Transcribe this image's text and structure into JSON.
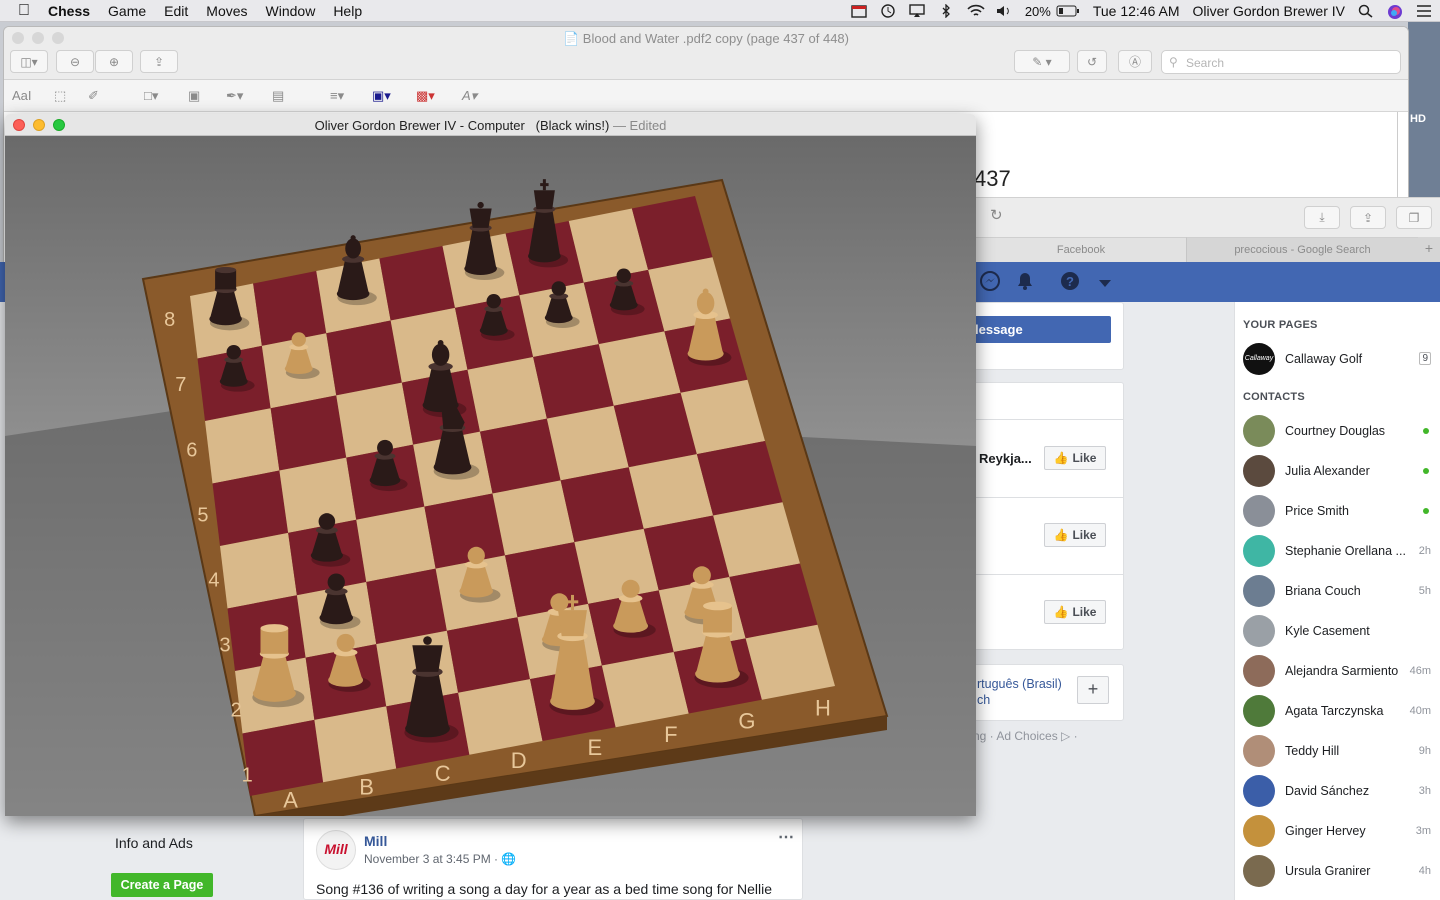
{
  "menubar": {
    "app": "Chess",
    "items": [
      "Game",
      "Edit",
      "Moves",
      "Window",
      "Help"
    ],
    "battery": "20%",
    "clock": "Tue 12:46 AM",
    "user": "Oliver Gordon Brewer IV"
  },
  "preview": {
    "title": "Blood and Water .pdf2 copy (page 437 of 448)",
    "search_placeholder": "Search",
    "page_fragment": "437",
    "hd_label": "HD",
    "markup_text_tool": "AaI"
  },
  "safari": {
    "tabs": [
      "Facebook",
      "precocious - Google Search"
    ]
  },
  "facebook": {
    "message_button": "lessage",
    "card_text": "Reykja...",
    "like_label": "Like",
    "language_links": [
      "rtuguês (Brasil)",
      "ch"
    ],
    "footer": "ng · Ad Choices ▷ ·",
    "info_and_ads": "Info and Ads",
    "create_page": "Create a Page",
    "post": {
      "author": "Mill",
      "time": "November 3 at 3:45 PM · ",
      "text": "Song #136 of writing a song a day for a year as a bed time song for Nellie",
      "avatar_text": "Mill"
    },
    "sidebar": {
      "your_pages": "YOUR PAGES",
      "page_name": "Callaway Golf",
      "page_count": "9",
      "contacts_header": "CONTACTS",
      "contacts": [
        {
          "name": "Courtney Douglas",
          "status": "online",
          "color": "#7a8b5a"
        },
        {
          "name": "Julia Alexander",
          "status": "online",
          "color": "#5b4a3e"
        },
        {
          "name": "Price Smith",
          "status": "online",
          "color": "#8a8f98"
        },
        {
          "name": "Stephanie Orellana ...",
          "status": "2h",
          "color": "#3fb6a4"
        },
        {
          "name": "Briana Couch",
          "status": "5h",
          "color": "#6c7d91"
        },
        {
          "name": "Kyle Casement",
          "status": "",
          "color": "#9aa0a6"
        },
        {
          "name": "Alejandra Sarmiento",
          "status": "46m",
          "color": "#8d6b5a"
        },
        {
          "name": "Agata Tarczynska",
          "status": "40m",
          "color": "#4f7a3a"
        },
        {
          "name": "Teddy Hill",
          "status": "9h",
          "color": "#b08e78"
        },
        {
          "name": "David Sánchez",
          "status": "3h",
          "color": "#3b5ea8"
        },
        {
          "name": "Ginger Hervey",
          "status": "3m",
          "color": "#c4913c"
        },
        {
          "name": "Ursula Granirer",
          "status": "4h",
          "color": "#7a6a4f"
        }
      ]
    }
  },
  "chess": {
    "title": "Oliver Gordon Brewer IV - Computer   (Black wins!)",
    "edited": " — Edited",
    "files": [
      "A",
      "B",
      "C",
      "D",
      "E",
      "F",
      "G",
      "H"
    ],
    "ranks": [
      "1",
      "2",
      "3",
      "4",
      "5",
      "6",
      "7",
      "8"
    ],
    "light_square_color": "#d9b98a",
    "dark_square_color": "#7b1f2b",
    "pieces": [
      {
        "side": "black",
        "type": "rook",
        "square": "a8"
      },
      {
        "side": "black",
        "type": "pawn",
        "square": "a7"
      },
      {
        "side": "black",
        "type": "bishop",
        "square": "c8"
      },
      {
        "side": "black",
        "type": "queen",
        "square": "e8"
      },
      {
        "side": "black",
        "type": "king",
        "square": "f8"
      },
      {
        "side": "black",
        "type": "pawn",
        "square": "e7"
      },
      {
        "side": "black",
        "type": "pawn",
        "square": "f7"
      },
      {
        "side": "black",
        "type": "pawn",
        "square": "g7"
      },
      {
        "side": "black",
        "type": "bishop",
        "square": "d6"
      },
      {
        "side": "black",
        "type": "knight",
        "square": "d5"
      },
      {
        "side": "black",
        "type": "pawn",
        "square": "c5"
      },
      {
        "side": "black",
        "type": "pawn",
        "square": "b4"
      },
      {
        "side": "black",
        "type": "pawn",
        "square": "b3"
      },
      {
        "side": "black",
        "type": "queen",
        "square": "c1"
      },
      {
        "side": "white",
        "type": "pawn",
        "square": "b7"
      },
      {
        "side": "white",
        "type": "bishop",
        "square": "h6"
      },
      {
        "side": "white",
        "type": "pawn",
        "square": "d3"
      },
      {
        "side": "white",
        "type": "pawn",
        "square": "e2"
      },
      {
        "side": "white",
        "type": "pawn",
        "square": "f2"
      },
      {
        "side": "white",
        "type": "pawn",
        "square": "g2"
      },
      {
        "side": "white",
        "type": "rook",
        "square": "a2"
      },
      {
        "side": "white",
        "type": "pawn",
        "square": "b2"
      },
      {
        "side": "white",
        "type": "king",
        "square": "e1"
      },
      {
        "side": "white",
        "type": "rook",
        "square": "g1"
      }
    ]
  }
}
